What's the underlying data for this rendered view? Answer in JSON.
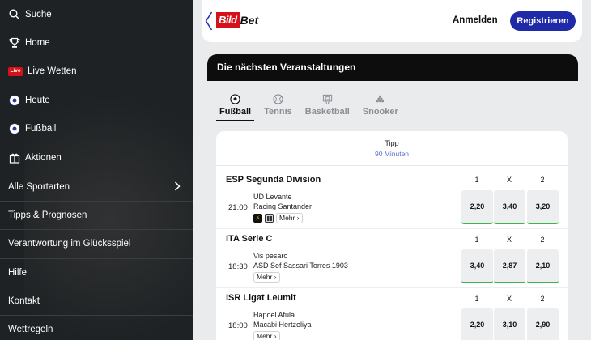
{
  "sidebar": {
    "items": [
      {
        "label": "Suche",
        "icon": "search-icon"
      },
      {
        "label": "Home",
        "icon": "trophy-icon"
      },
      {
        "label": "Live Wetten",
        "icon": "live-badge",
        "badge": "Live"
      },
      {
        "label": "Heute",
        "icon": "soccer-ball-icon"
      },
      {
        "label": "Fußball",
        "icon": "soccer-ball-icon"
      },
      {
        "label": "Aktionen",
        "icon": "gift-icon"
      },
      {
        "label": "Alle Sportarten",
        "icon": "chevron-right-icon"
      },
      {
        "label": "Tipps & Prognosen"
      },
      {
        "label": "Verantwortung im Glücksspiel"
      },
      {
        "label": "Hilfe"
      },
      {
        "label": "Kontakt"
      },
      {
        "label": "Wettregeln"
      }
    ]
  },
  "header": {
    "logo_part1": "Bild",
    "logo_part2": "Bet",
    "login_label": "Anmelden",
    "register_label": "Registrieren",
    "accent_color": "#1f2aa8"
  },
  "events": {
    "title": "Die nächsten Veranstaltungen",
    "tabs": [
      {
        "label": "Fußball",
        "icon": "soccer-ball-icon",
        "active": true
      },
      {
        "label": "Tennis",
        "icon": "tennis-ball-icon",
        "active": false
      },
      {
        "label": "Basketball",
        "icon": "basketball-icon",
        "active": false
      },
      {
        "label": "Snooker",
        "icon": "snooker-icon",
        "active": false
      }
    ],
    "market": "Tipp",
    "market_sub": "90 Minuten",
    "leagues": [
      {
        "name": "ESP Segunda Division",
        "cols": [
          "1",
          "X",
          "2"
        ],
        "time": "21:00",
        "home": "UD Levante",
        "away": "Racing Santander",
        "more": "Mehr",
        "odds": [
          "2,20",
          "3,40",
          "3,20"
        ]
      },
      {
        "name": "ITA Serie C",
        "cols": [
          "1",
          "X",
          "2"
        ],
        "time": "18:30",
        "home": "Vis pesaro",
        "away": "ASD Sef Sassari Torres 1903",
        "more": "Mehr",
        "odds": [
          "3,40",
          "2,87",
          "2,10"
        ]
      },
      {
        "name": "ISR Ligat Leumit",
        "cols": [
          "1",
          "X",
          "2"
        ],
        "time": "18:00",
        "home": "Hapoel Afula",
        "away": "Macabi Hertzeliya",
        "more": "Mehr",
        "odds": [
          "2,20",
          "3,10",
          "2,90"
        ]
      }
    ]
  }
}
